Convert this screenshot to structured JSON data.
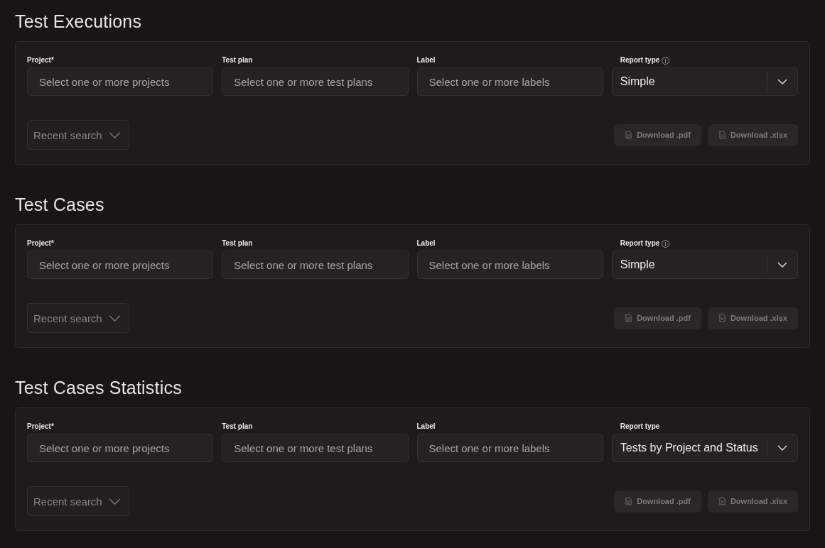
{
  "sections": [
    {
      "title": "Test Executions",
      "filters": [
        {
          "label": "Project*",
          "placeholder": "Select one or more projects"
        },
        {
          "label": "Test plan",
          "placeholder": "Select one or more test plans"
        },
        {
          "label": "Label",
          "placeholder": "Select one or more labels"
        }
      ],
      "report_type": {
        "label": "Report type",
        "info": true,
        "value": "Simple"
      },
      "recent_search": {
        "placeholder": "Recent search"
      },
      "buttons": [
        {
          "kind": "pdf",
          "label": "Download .pdf",
          "disabled": true
        },
        {
          "kind": "xlsx",
          "label": "Download .xlsx",
          "disabled": true
        }
      ]
    },
    {
      "title": "Test Cases",
      "filters": [
        {
          "label": "Project*",
          "placeholder": "Select one or more projects"
        },
        {
          "label": "Test plan",
          "placeholder": "Select one or more test plans"
        },
        {
          "label": "Label",
          "placeholder": "Select one or more labels"
        }
      ],
      "report_type": {
        "label": "Report type",
        "info": true,
        "value": "Simple"
      },
      "recent_search": {
        "placeholder": "Recent search"
      },
      "buttons": [
        {
          "kind": "pdf",
          "label": "Download .pdf",
          "disabled": true
        },
        {
          "kind": "xlsx",
          "label": "Download .xlsx",
          "disabled": true
        }
      ]
    },
    {
      "title": "Test Cases Statistics",
      "filters": [
        {
          "label": "Project*",
          "placeholder": "Select one or more projects"
        },
        {
          "label": "Test plan",
          "placeholder": "Select one or more test plans"
        },
        {
          "label": "Label",
          "placeholder": "Select one or more labels"
        }
      ],
      "report_type": {
        "label": "Report type",
        "info": false,
        "value": "Tests by Project and Status"
      },
      "recent_search": {
        "placeholder": "Recent search"
      },
      "buttons": [
        {
          "kind": "pdf",
          "label": "Download .pdf",
          "disabled": true
        },
        {
          "kind": "xlsx",
          "label": "Download .xlsx",
          "disabled": true
        }
      ]
    }
  ]
}
